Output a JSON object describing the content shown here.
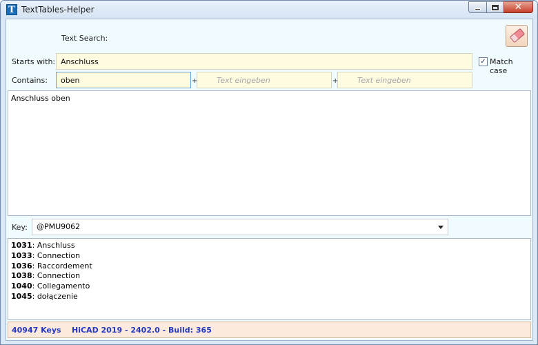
{
  "window": {
    "title": "TextTables-Helper",
    "app_icon_letter": "T",
    "close_glyph": "✕"
  },
  "search": {
    "section_label": "Text Search:",
    "starts_with_label": "Starts with:",
    "starts_with_value": "Anschluss",
    "contains_label": "Contains:",
    "contains_value": "oben",
    "plus_1": "+",
    "plus_2": "+",
    "extra_field_1_placeholder": "Text eingeben",
    "extra_field_2_placeholder": "Text eingeben",
    "match_case_label": "Match case",
    "match_case_checked": true,
    "checkmark": "✓",
    "clear_icon": "eraser-icon"
  },
  "results": {
    "items": [
      "Anschluss oben"
    ]
  },
  "key": {
    "label": "Key:",
    "selected_value": "@PMU9062"
  },
  "translations": [
    {
      "code": "1031",
      "text": "Anschluss"
    },
    {
      "code": "1033",
      "text": "Connection"
    },
    {
      "code": "1036",
      "text": "Raccordement"
    },
    {
      "code": "1038",
      "text": "Connection"
    },
    {
      "code": "1040",
      "text": "Collegamento"
    },
    {
      "code": "1045",
      "text": "dołączenie"
    }
  ],
  "status": {
    "keys_count": "40947 Keys",
    "build_info": "HiCAD 2019 - 2402.0 - Build: 365"
  }
}
